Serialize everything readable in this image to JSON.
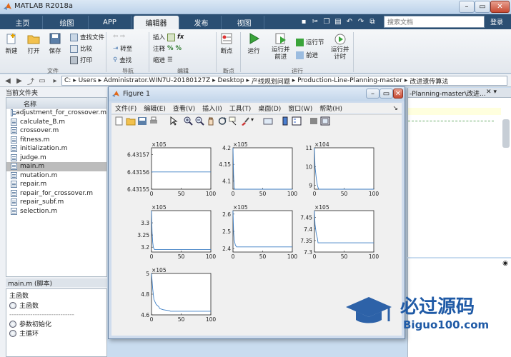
{
  "window": {
    "title": "MATLAB R2018a"
  },
  "tabs": [
    "主页",
    "绘图",
    "APP",
    "编辑器",
    "发布",
    "视图"
  ],
  "active_tab": "编辑器",
  "search": {
    "placeholder": "搜索文档"
  },
  "login_label": "登录",
  "ribbon": {
    "file_group": {
      "label": "文件",
      "new": "新建",
      "open": "打开",
      "save": "保存",
      "find_files": "查找文件",
      "compare": "比较",
      "print": "打印"
    },
    "nav_group": {
      "label": "导航",
      "goto": "转至",
      "find": "查找"
    },
    "edit_group": {
      "label": "编辑",
      "insert": "插入",
      "comment": "注释",
      "indent": "缩进"
    },
    "bp_group": {
      "label": "断点",
      "breakpoints": "断点"
    },
    "run_group": {
      "label": "运行",
      "run": "运行",
      "run_advance": "运行并\n前进",
      "run_section": "运行节",
      "advance": "前进",
      "run_time": "运行并\n计时"
    }
  },
  "address": {
    "segments": [
      "C:",
      "Users",
      "Administrator.WIN7U-20180127Z",
      "Desktop",
      "产线规划问题",
      "Production-Line-Planning-master",
      "改进遗传算法"
    ]
  },
  "current_folder": {
    "title": "当前文件夹",
    "column": "名称",
    "files": [
      "adjustment_for_crossover.m",
      "calculate_B.m",
      "crossover.m",
      "fitness.m",
      "initialization.m",
      "judge.m",
      "main.m",
      "mutation.m",
      "repair.m",
      "repair_for_crossover.m",
      "repair_subf.m",
      "selection.m"
    ],
    "selected": "main.m"
  },
  "details": {
    "title": "main.m  (脚本)",
    "heading": "主函数",
    "items": [
      "主函数",
      "参数初始化",
      "主循环"
    ]
  },
  "editor": {
    "tab_fragment": "-Planning-master\\改进..."
  },
  "figure": {
    "title": "Figure 1",
    "menu": [
      "文件(F)",
      "编辑(E)",
      "查看(V)",
      "插入(I)",
      "工具(T)",
      "桌面(D)",
      "窗口(W)",
      "帮助(H)"
    ],
    "toolbar_icons": [
      "new-figure-icon",
      "open-icon",
      "save-icon",
      "print-icon",
      "pointer-icon",
      "zoom-in-icon",
      "zoom-out-icon",
      "pan-icon",
      "rotate-icon",
      "data-cursor-icon",
      "brush-icon",
      "link-icon",
      "colorbar-icon",
      "legend-icon",
      "hide-plot-tools-icon",
      "show-plot-tools-icon"
    ]
  },
  "watermark": {
    "brand": "必过源码",
    "site": "Biguo100.com"
  },
  "chart_data": [
    {
      "type": "line",
      "x_ticks": [
        "0",
        "50",
        "100"
      ],
      "y_ticks": [
        "6.43155",
        "6.43156",
        "6.43157"
      ],
      "exponent": "×10^5",
      "xlim": [
        0,
        100
      ],
      "ylim": [
        643155,
        643157.4
      ],
      "series": [
        {
          "x": [
            0,
            100
          ],
          "y": [
            643156,
            643156
          ]
        }
      ]
    },
    {
      "type": "line",
      "x_ticks": [
        "0",
        "50",
        "100"
      ],
      "y_ticks": [
        "4.1",
        "4.15",
        "4.2"
      ],
      "exponent": "×10^5",
      "xlim": [
        0,
        100
      ],
      "ylim": [
        407500,
        420000
      ],
      "series": [
        {
          "x": [
            0,
            1,
            2,
            3,
            100
          ],
          "y": [
            420000,
            412000,
            408000,
            407500,
            407500
          ]
        }
      ]
    },
    {
      "type": "line",
      "x_ticks": [
        "0",
        "50",
        "100"
      ],
      "y_ticks": [
        "9",
        "10",
        "11"
      ],
      "exponent": "×10^4",
      "xlim": [
        0,
        100
      ],
      "ylim": [
        88000,
        110000
      ],
      "series": [
        {
          "x": [
            0,
            1,
            3,
            5,
            7,
            100
          ],
          "y": [
            110000,
            100000,
            94000,
            90000,
            88000,
            88000
          ]
        }
      ]
    },
    {
      "type": "line",
      "x_ticks": [
        "0",
        "50",
        "100"
      ],
      "y_ticks": [
        "3.2",
        "3.25",
        "3.3"
      ],
      "exponent": "×10^5",
      "xlim": [
        0,
        100
      ],
      "ylim": [
        318000,
        335000
      ],
      "series": [
        {
          "x": [
            0,
            1,
            2,
            3,
            5,
            100
          ],
          "y": [
            335000,
            326000,
            322000,
            320000,
            319000,
            319000
          ]
        }
      ]
    },
    {
      "type": "line",
      "x_ticks": [
        "0",
        "50",
        "100"
      ],
      "y_ticks": [
        "2.4",
        "2.5",
        "2.6"
      ],
      "exponent": "×10^5",
      "xlim": [
        0,
        100
      ],
      "ylim": [
        238000,
        262000
      ],
      "series": [
        {
          "x": [
            0,
            1,
            2,
            4,
            6,
            100
          ],
          "y": [
            262000,
            250000,
            245000,
            242000,
            241000,
            241000
          ]
        }
      ]
    },
    {
      "type": "line",
      "x_ticks": [
        "0",
        "50",
        "100"
      ],
      "y_ticks": [
        "7.3",
        "7.35",
        "7.4",
        "7.45"
      ],
      "exponent": "×10^5",
      "xlim": [
        0,
        100
      ],
      "ylim": [
        730000,
        748000
      ],
      "series": [
        {
          "x": [
            0,
            1,
            3,
            5,
            6,
            100
          ],
          "y": [
            748000,
            742000,
            738000,
            736000,
            734000,
            734000
          ]
        }
      ]
    },
    {
      "type": "line",
      "x_ticks": [
        "0",
        "50",
        "100"
      ],
      "y_ticks": [
        "4.6",
        "4.8",
        "5"
      ],
      "exponent": "×10^5",
      "xlim": [
        0,
        100
      ],
      "ylim": [
        460000,
        500000
      ],
      "series": [
        {
          "x": [
            0,
            2,
            4,
            8,
            12,
            14,
            20,
            30,
            32,
            100
          ],
          "y": [
            500000,
            485000,
            475000,
            470000,
            468000,
            466000,
            465000,
            464000,
            463500,
            463500
          ]
        }
      ]
    }
  ]
}
